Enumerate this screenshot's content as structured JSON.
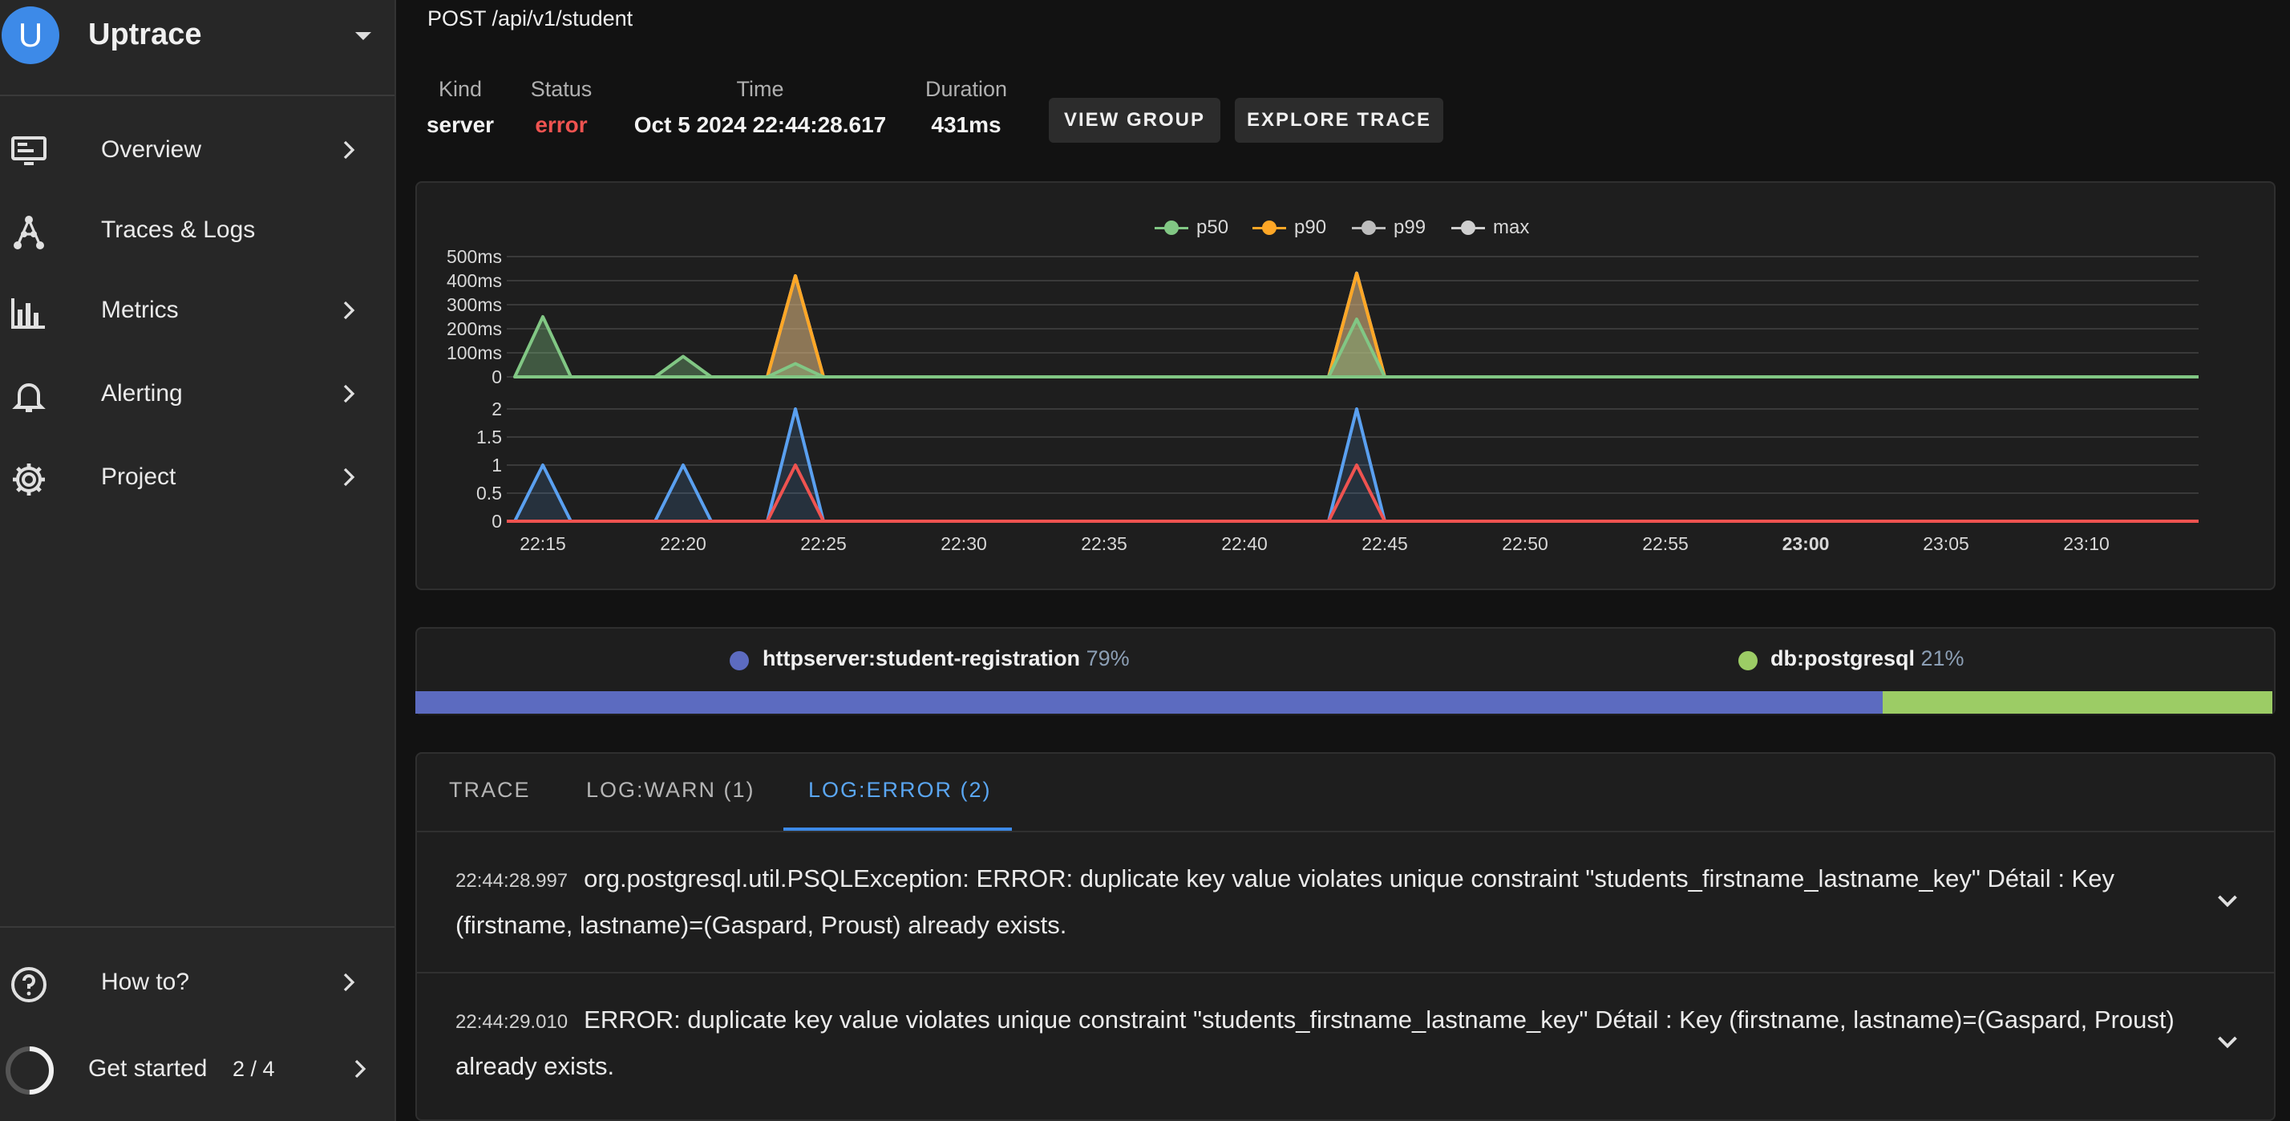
{
  "app": {
    "name": "Uptrace",
    "avatar_letter": "U"
  },
  "sidebar": {
    "items": [
      {
        "label": "Overview",
        "icon": "monitor-icon"
      },
      {
        "label": "Traces & Logs",
        "icon": "traces-icon"
      },
      {
        "label": "Metrics",
        "icon": "bar-chart-icon"
      },
      {
        "label": "Alerting",
        "icon": "bell-icon"
      },
      {
        "label": "Project",
        "icon": "gear-icon"
      }
    ],
    "howto": {
      "label": "How to?",
      "icon": "help-circle-icon"
    },
    "get_started": {
      "label": "Get started",
      "count": "2 / 4",
      "progress": 0.5
    }
  },
  "header": {
    "title": "POST /api/v1/student",
    "kind_label": "Kind",
    "kind_value": "server",
    "status_label": "Status",
    "status_value": "error",
    "time_label": "Time",
    "time_value": "Oct 5 2024 22:44:28.617",
    "duration_label": "Duration",
    "duration_value": "431ms",
    "view_group": "VIEW GROUP",
    "explore_trace": "EXPLORE TRACE"
  },
  "colors": {
    "p50": "#81c784",
    "p90": "#ffa726",
    "p99": "#bdbdbd",
    "max": "#cfcfcf",
    "count": "#5aa0f0",
    "errors": "#ef5350",
    "httpserver": "#5c6bc0",
    "db": "#9ccc65",
    "accent": "#3d8ae8"
  },
  "chart_data": [
    {
      "type": "area",
      "x_labels": [
        "22:15",
        "22:20",
        "22:25",
        "22:30",
        "22:35",
        "22:40",
        "22:45",
        "22:50",
        "22:55",
        "23:00",
        "23:05",
        "23:10"
      ],
      "y_ticks": [
        "500ms",
        "400ms",
        "300ms",
        "200ms",
        "100ms",
        "0"
      ],
      "ylim": [
        0,
        500
      ],
      "legend": [
        "p50",
        "p90",
        "p99",
        "max"
      ],
      "series": [
        {
          "name": "p50",
          "points": [
            [
              "22:15",
              250
            ],
            [
              "22:20",
              85
            ],
            [
              "22:24",
              55
            ],
            [
              "22:44",
              240
            ]
          ]
        },
        {
          "name": "p90",
          "points": [
            [
              "22:24",
              420
            ],
            [
              "22:44",
              430
            ]
          ]
        },
        {
          "name": "p99",
          "points": [
            [
              "22:24",
              420
            ],
            [
              "22:44",
              431
            ]
          ]
        },
        {
          "name": "max",
          "points": [
            [
              "22:24",
              420
            ],
            [
              "22:44",
              431
            ]
          ]
        }
      ]
    },
    {
      "type": "line",
      "x_labels": [
        "22:15",
        "22:20",
        "22:25",
        "22:30",
        "22:35",
        "22:40",
        "22:45",
        "22:50",
        "22:55",
        "23:00",
        "23:05",
        "23:10"
      ],
      "y_ticks": [
        "2",
        "1.5",
        "1",
        "0.5",
        "0"
      ],
      "ylim": [
        0,
        2
      ],
      "series": [
        {
          "points": [
            [
              "22:15",
              1
            ],
            [
              "22:20",
              1
            ],
            [
              "22:24",
              2
            ],
            [
              "22:44",
              2
            ]
          ]
        },
        {
          "points": [
            [
              "22:24",
              1
            ],
            [
              "22:44",
              1
            ]
          ]
        }
      ]
    }
  ],
  "breakdown": [
    {
      "name": "httpserver:student-registration",
      "pct": "79%",
      "value": 0.79
    },
    {
      "name": "db:postgresql",
      "pct": "21%",
      "value": 0.21
    }
  ],
  "tabs": [
    {
      "label": "TRACE"
    },
    {
      "label": "LOG:WARN (1)"
    },
    {
      "label": "LOG:ERROR (2)",
      "active": true
    }
  ],
  "logs": [
    {
      "time": "22:44:28.997",
      "message": "org.postgresql.util.PSQLException: ERROR: duplicate key value violates unique constraint \"students_firstname_lastname_key\" Détail : Key (firstname, lastname)=(Gaspard, Proust) already exists."
    },
    {
      "time": "22:44:29.010",
      "message": "ERROR: duplicate key value violates unique constraint \"students_firstname_lastname_key\" Détail : Key (firstname, lastname)=(Gaspard, Proust) already exists."
    }
  ]
}
